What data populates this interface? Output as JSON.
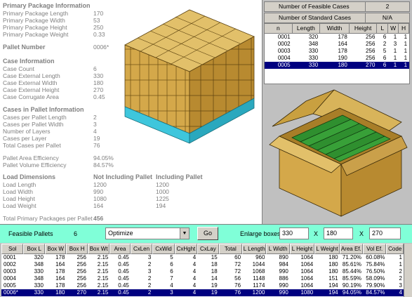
{
  "primary_package": {
    "heading": "Primary Package Information",
    "rows": [
      {
        "label": "Primary Package Length",
        "value": "170"
      },
      {
        "label": "Primary Package Width",
        "value": "53"
      },
      {
        "label": "Primary Package Height",
        "value": "250"
      },
      {
        "label": "Primary Package Weight",
        "value": "0.33"
      }
    ]
  },
  "pallet": {
    "label": "Pallet Number",
    "value": "0006*"
  },
  "case_info": {
    "heading": "Case Information",
    "rows": [
      {
        "label": "Case Count",
        "value": "6"
      },
      {
        "label": "Case External Length",
        "value": "330"
      },
      {
        "label": "Case External Width",
        "value": "180"
      },
      {
        "label": "Case External Height",
        "value": "270"
      },
      {
        "label": "Case Corrugate Area",
        "value": "0.45"
      }
    ]
  },
  "cases_in_pallet": {
    "heading": "Cases in Pallet Information",
    "rows": [
      {
        "label": "Cases per Pallet Length",
        "value": "2"
      },
      {
        "label": "Cases per Pallet Width",
        "value": "3"
      },
      {
        "label": "Number of Layers",
        "value": "4"
      },
      {
        "label": "Cases per Layer",
        "value": "19"
      },
      {
        "label": "Total Cases per Pallet",
        "value": "76"
      }
    ]
  },
  "efficiency": {
    "rows": [
      {
        "label": "Pallet Area Efficiency",
        "value": "94.05%"
      },
      {
        "label": "Pallet Volume Efficiency",
        "value": "84.57%"
      }
    ]
  },
  "load_dimensions": {
    "heading": "Load Dimensions",
    "col1": "Not Including Pallet",
    "col2": "Including Pallet",
    "rows": [
      {
        "label": "Load Length",
        "v1": "1200",
        "v2": "1200"
      },
      {
        "label": "Load Width",
        "v1": "990",
        "v2": "1000"
      },
      {
        "label": "Load Height",
        "v1": "1080",
        "v2": "1225"
      },
      {
        "label": "Load Weight",
        "v1": "164",
        "v2": "194"
      }
    ]
  },
  "total_primary": {
    "label": "Total Primary Packages per Pallet",
    "value": "456"
  },
  "summary": {
    "feasible_label": "Number of Feasible Cases",
    "feasible_value": "2",
    "standard_label": "Number of Standard Cases",
    "standard_value": "N/A"
  },
  "case_grid": {
    "headers": [
      "n",
      "Length",
      "Width",
      "Height",
      "L",
      "W",
      "H"
    ],
    "rows": [
      [
        "0001",
        "320",
        "178",
        "256",
        "6",
        "1",
        "1"
      ],
      [
        "0002",
        "348",
        "164",
        "256",
        "2",
        "3",
        "1"
      ],
      [
        "0003",
        "330",
        "178",
        "256",
        "5",
        "1",
        "1"
      ],
      [
        "0004",
        "330",
        "190",
        "256",
        "6",
        "1",
        "1"
      ],
      [
        "0005",
        "330",
        "180",
        "270",
        "6",
        "1",
        "1"
      ]
    ],
    "selected": 4
  },
  "toolbar": {
    "feasible_label": "Feasible Pallets",
    "feasible_value": "6",
    "select_value": "Optimize",
    "go_label": "Go",
    "enlarge_label": "Enlarge boxes",
    "box_l": "330",
    "box_w": "180",
    "box_h": "270",
    "x1": "X",
    "x2": "X"
  },
  "pallet_grid": {
    "headers": [
      "Sol",
      "Box L",
      "Box W",
      "Box H",
      "Box Wt",
      "Area",
      "CxLen",
      "CxWid",
      "CxHght",
      "CxLay",
      "Total",
      "L Length",
      "L Width",
      "L Height",
      "L Weight",
      "Area Ef.",
      "Vol Ef.",
      "Code"
    ],
    "rows": [
      [
        "0001",
        "320",
        "178",
        "256",
        "2.15",
        "0.45",
        "3",
        "5",
        "4",
        "15",
        "60",
        "960",
        "890",
        "1064",
        "180",
        "71.20%",
        "60.08%",
        "1"
      ],
      [
        "0002",
        "348",
        "164",
        "256",
        "2.15",
        "0.45",
        "2",
        "6",
        "4",
        "18",
        "72",
        "1044",
        "984",
        "1064",
        "180",
        "85.61%",
        "75.84%",
        "1"
      ],
      [
        "0003",
        "330",
        "178",
        "256",
        "2.15",
        "0.45",
        "3",
        "6",
        "4",
        "18",
        "72",
        "1068",
        "990",
        "1064",
        "180",
        "85.44%",
        "76.50%",
        "2"
      ],
      [
        "0004",
        "348",
        "164",
        "256",
        "2.15",
        "0.45",
        "2",
        "7",
        "4",
        "14",
        "56",
        "1148",
        "886",
        "1064",
        "151",
        "85.59%",
        "58.09%",
        "2"
      ],
      [
        "0005",
        "330",
        "178",
        "256",
        "2.15",
        "0.45",
        "2",
        "4",
        "4",
        "19",
        "76",
        "1174",
        "990",
        "1064",
        "194",
        "90.19%",
        "79.90%",
        "3"
      ],
      [
        "0006*",
        "330",
        "180",
        "270",
        "2.15",
        "0.45",
        "2",
        "3",
        "4",
        "19",
        "76",
        "1200",
        "990",
        "1080",
        "194",
        "94.05%",
        "84.57%",
        "4"
      ]
    ],
    "selected": 5
  }
}
